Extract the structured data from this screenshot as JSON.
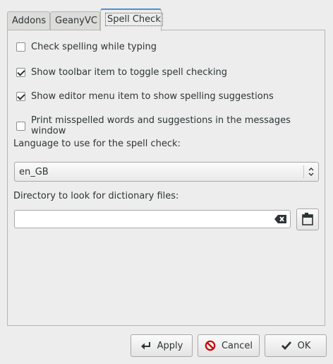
{
  "tabs": [
    {
      "label": "Addons"
    },
    {
      "label": "GeanyVC"
    },
    {
      "label": "Spell Check"
    }
  ],
  "options": {
    "check_while_typing": {
      "label": "Check spelling while typing",
      "checked": false
    },
    "toolbar_item": {
      "label": "Show toolbar item to toggle spell checking",
      "checked": true
    },
    "editor_menu_item": {
      "label": "Show editor menu item to show spelling suggestions",
      "checked": true
    },
    "print_misspelled": {
      "label": "Print misspelled words and suggestions in the messages window",
      "checked": false
    }
  },
  "language": {
    "label": "Language to use for the spell check:",
    "selected": "en_GB"
  },
  "directory": {
    "label": "Directory to look for dictionary files:",
    "value": ""
  },
  "buttons": {
    "apply": "Apply",
    "cancel": "Cancel",
    "ok": "OK"
  },
  "icons": {
    "apply": "apply-arrow-icon",
    "cancel": "cancel-icon",
    "ok": "checkmark-icon",
    "clear": "clear-text-icon",
    "folder": "open-folder-icon",
    "combo_arrow": "updown-arrows-icon"
  },
  "colors": {
    "active_tab_accent": "#4a90d9",
    "cancel_icon": "#cc0000"
  }
}
